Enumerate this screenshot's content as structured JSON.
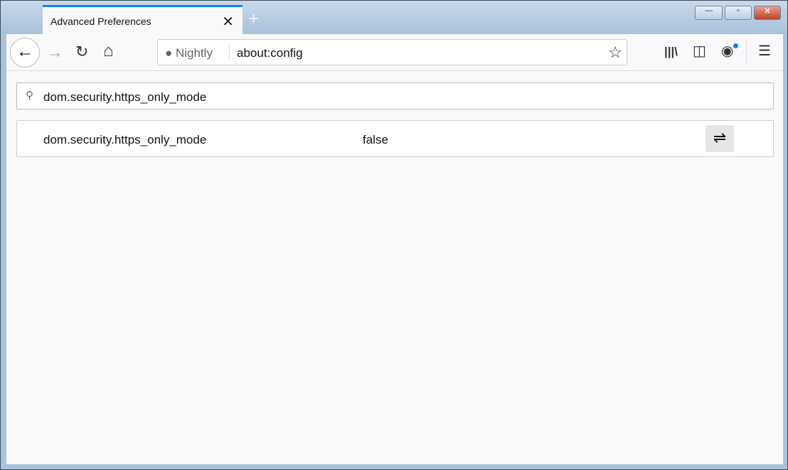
{
  "window": {
    "tab_title": "Advanced Preferences",
    "close_tab": "✕",
    "new_tab": "+",
    "minimize": "—",
    "maximize": "▫",
    "close": "✕"
  },
  "toolbar": {
    "back": "←",
    "forward": "→",
    "reload": "↻",
    "home": "⌂",
    "brand": "Nightly",
    "url": "about:config",
    "bookmark_star": "☆",
    "library": "|||\\",
    "sidebar": "◫",
    "account": "◉",
    "menu": "☰",
    "account_badge_color": "#0a84ff"
  },
  "config": {
    "search_value": "dom.security.https_only_mode",
    "search_icon": "⚲",
    "pref_name": "dom.security.https_only_mode",
    "pref_value": "false",
    "toggle": "⇌"
  }
}
